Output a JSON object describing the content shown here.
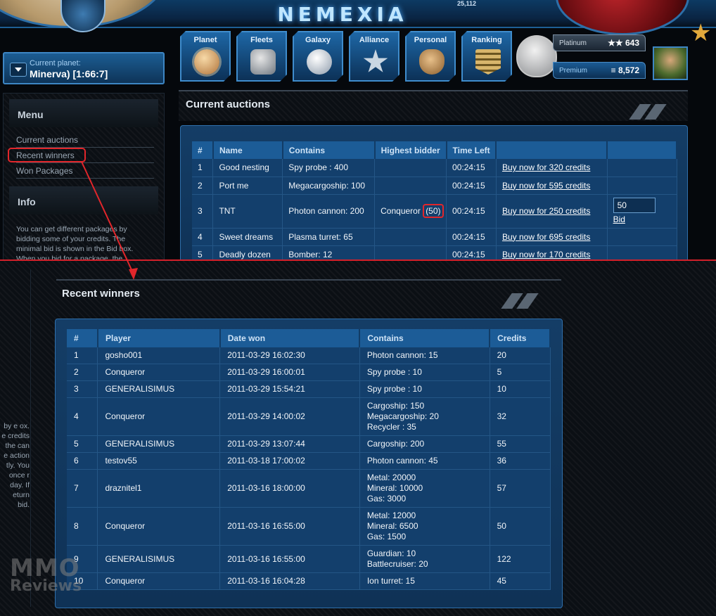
{
  "header": {
    "logo_text": "NEMEXIA",
    "counter": "25,112",
    "current_planet_label": "Current planet:",
    "current_planet_value": "Minerva) [1:66:7]",
    "nav": [
      "Planet",
      "Fleets",
      "Galaxy",
      "Alliance",
      "Personal",
      "Ranking"
    ],
    "platinum_label": "Platinum",
    "platinum_value": "643",
    "premium_label": "Premium",
    "premium_value": "8,572"
  },
  "sidebar": {
    "menu_title": "Menu",
    "items": [
      "Current auctions",
      "Recent winners",
      "Won Packages"
    ],
    "info_title": "Info",
    "info_text": "You can get different packages by bidding some of your credits. The minimal bid is shown in the Bid box. When you bid for a package, the credits"
  },
  "auctions": {
    "title": "Current auctions",
    "columns": [
      "#",
      "Name",
      "Contains",
      "Highest bidder",
      "Time Left",
      "",
      ""
    ],
    "rows": [
      {
        "num": "1",
        "name": "Good nesting",
        "contains": "Spy probe : 400",
        "bidder": "",
        "bid": "",
        "time": "00:24:15",
        "buy": "Buy now for 320 credits"
      },
      {
        "num": "2",
        "name": "Port me",
        "contains": "Megacargoship: 100",
        "bidder": "",
        "bid": "",
        "time": "00:24:15",
        "buy": "Buy now for 595 credits"
      },
      {
        "num": "3",
        "name": "TNT",
        "contains": "Photon cannon: 200",
        "bidder": "Conqueror",
        "bid": "(50)",
        "time": "00:24:15",
        "buy": "Buy now for 250 credits",
        "bid_input": "50",
        "bid_label": "Bid"
      },
      {
        "num": "4",
        "name": "Sweet dreams",
        "contains": "Plasma turret: 65",
        "bidder": "",
        "bid": "",
        "time": "00:24:15",
        "buy": "Buy now for 695 credits"
      },
      {
        "num": "5",
        "name": "Deadly dozen",
        "contains": "Bomber: 12",
        "bidder": "",
        "bid": "",
        "time": "00:24:15",
        "buy": "Buy now for 170 credits"
      }
    ]
  },
  "bottom_left_text": "by e ox. e credits the can e action tly. You once r day. If eturn bid.",
  "winners": {
    "title": "Recent winners",
    "columns": [
      "#",
      "Player",
      "Date won",
      "Contains",
      "Credits"
    ],
    "rows": [
      {
        "num": "1",
        "player": "gosho001",
        "date": "2011-03-29 16:02:30",
        "contains": [
          "Photon cannon: 15"
        ],
        "credits": "20"
      },
      {
        "num": "2",
        "player": "Conqueror",
        "date": "2011-03-29 16:00:01",
        "contains": [
          "Spy probe : 10"
        ],
        "credits": "5"
      },
      {
        "num": "3",
        "player": "GENERALISIMUS",
        "date": "2011-03-29 15:54:21",
        "contains": [
          "Spy probe : 10"
        ],
        "credits": "10"
      },
      {
        "num": "4",
        "player": "Conqueror",
        "date": "2011-03-29 14:00:02",
        "contains": [
          "Cargoship: 150",
          "Megacargoship: 20",
          "Recycler : 35"
        ],
        "credits": "32"
      },
      {
        "num": "5",
        "player": "GENERALISIMUS",
        "date": "2011-03-29 13:07:44",
        "contains": [
          "Cargoship: 200"
        ],
        "credits": "55"
      },
      {
        "num": "6",
        "player": "testov55",
        "date": "2011-03-18 17:00:02",
        "contains": [
          "Photon cannon: 45"
        ],
        "credits": "36"
      },
      {
        "num": "7",
        "player": "draznitel1",
        "date": "2011-03-16 18:00:00",
        "contains": [
          "Metal: 20000",
          "Mineral: 10000",
          "Gas: 3000"
        ],
        "credits": "57"
      },
      {
        "num": "8",
        "player": "Conqueror",
        "date": "2011-03-16 16:55:00",
        "contains": [
          "Metal: 12000",
          "Mineral: 6500",
          "Gas: 1500"
        ],
        "credits": "50"
      },
      {
        "num": "9",
        "player": "GENERALISIMUS",
        "date": "2011-03-16 16:55:00",
        "contains": [
          "Guardian: 10",
          "Battlecruiser: 20"
        ],
        "credits": "122"
      },
      {
        "num": "10",
        "player": "Conqueror",
        "date": "2011-03-16 16:04:28",
        "contains": [
          "Ion turret: 15"
        ],
        "credits": "45"
      }
    ]
  },
  "watermark": {
    "line1": "MMO",
    "line2": "Reviews"
  },
  "colors": {
    "highlight": "#e2262b",
    "panel": "#143d66",
    "header_cell": "#1c5c97"
  }
}
